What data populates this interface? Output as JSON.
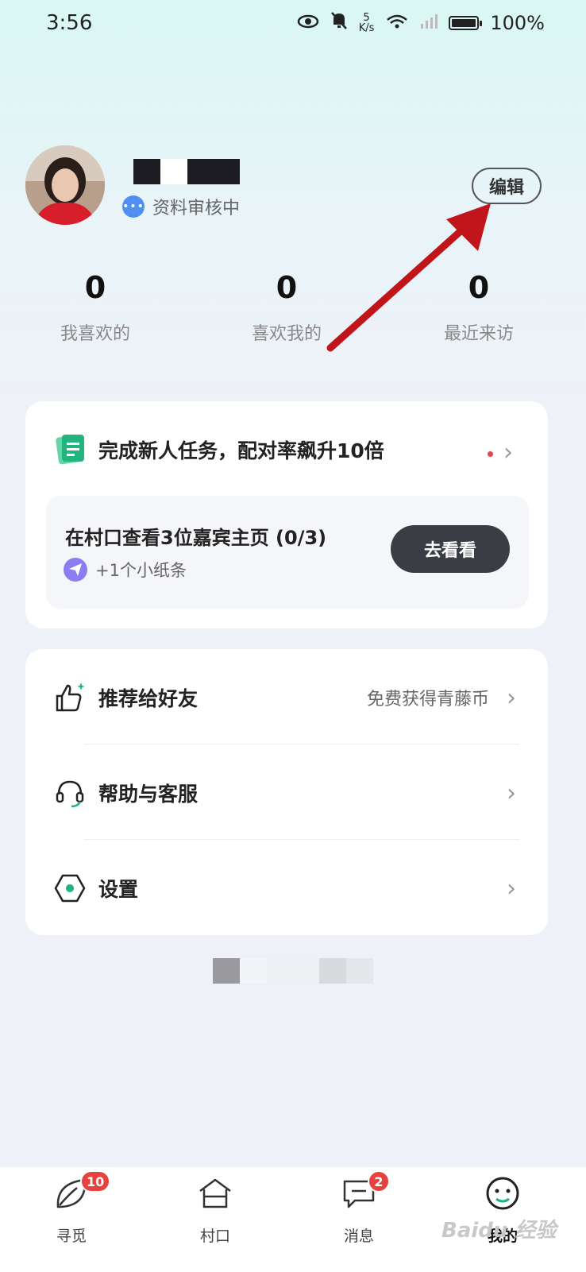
{
  "status_bar": {
    "time": "3:56",
    "net_speed_value": "5",
    "net_speed_unit": "K/s",
    "battery_percent": "100%",
    "battery_level": 1.0
  },
  "profile": {
    "review_status": "资料审核中",
    "edit_label": "编辑"
  },
  "stats": [
    {
      "count": "0",
      "label": "我喜欢的"
    },
    {
      "count": "0",
      "label": "喜欢我的"
    },
    {
      "count": "0",
      "label": "最近来访"
    }
  ],
  "task_card": {
    "title": "完成新人任务，配对率飙升10倍",
    "task": "在村口查看3位嘉宾主页 (0/3)",
    "reward": "+1个小纸条",
    "action_label": "去看看"
  },
  "menu": [
    {
      "label": "推荐给好友",
      "hint": "免费获得青藤币",
      "icon": "thumbs-up-icon"
    },
    {
      "label": "帮助与客服",
      "hint": "",
      "icon": "headset-icon"
    },
    {
      "label": "设置",
      "hint": "",
      "icon": "hexagon-settings-icon"
    }
  ],
  "tabbar": [
    {
      "label": "寻觅",
      "badge": "10",
      "icon": "leaf-icon"
    },
    {
      "label": "村口",
      "badge": "",
      "icon": "house-icon"
    },
    {
      "label": "消息",
      "badge": "2",
      "icon": "chat-icon"
    },
    {
      "label": "我的",
      "badge": "",
      "icon": "smiley-icon",
      "active": true
    }
  ],
  "watermark": "Baidu 经验",
  "colors": {
    "accent_green": "#1fb47d",
    "dark_button": "#3a3d44",
    "badge_red": "#e8423f",
    "annotation_arrow": "#c0161b"
  }
}
